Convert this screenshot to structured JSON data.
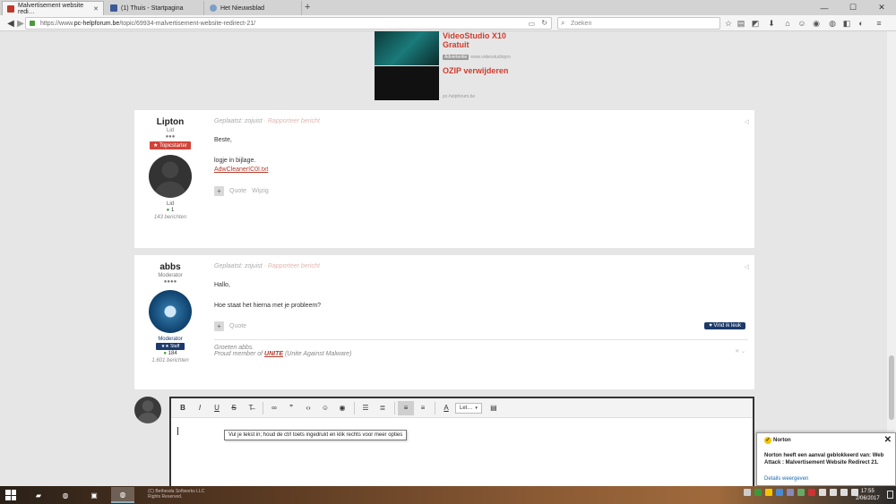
{
  "browser": {
    "tabs": [
      {
        "title": "Malvertisement website redi…",
        "active": true
      },
      {
        "title": "(1) Thuis - Startpagina",
        "active": false
      },
      {
        "title": "Het Nieuwsblad",
        "active": false
      }
    ],
    "new_tab": "+",
    "window": {
      "minimize": "—",
      "maximize": "☐",
      "close": "✕"
    },
    "url_prefix": "https://www.",
    "url_domain": "pc-helpforum.be",
    "url_path": "/topic/69934-malvertisement-website-redirect-21/",
    "search_placeholder": "Zoeken"
  },
  "ads": [
    {
      "title": "VideoStudio X10 Gratuit",
      "badge": "Advertentie",
      "source": "www.videostudiopro"
    },
    {
      "title": "OZIP verwijderen",
      "source": "pc-helpforum.be"
    }
  ],
  "posts": [
    {
      "author": "Lipton",
      "role": "Lid",
      "pips": "●●●",
      "badge": "★ Topicstarter",
      "group": "Lid",
      "reputation": "1",
      "count": "143 berichten",
      "posted": "Geplaatst: zojuist",
      "report": " · Rapporteer bericht",
      "lines": [
        "Beste,",
        "logje in bijlage."
      ],
      "attachment": "AdwCleanerIC0I.txt",
      "actions": [
        "Quote",
        "Wijzig"
      ]
    },
    {
      "author": "abbs",
      "role": "Moderator",
      "pips": "●●●●",
      "group": "Moderator",
      "staff": "★★     Staff",
      "reputation": "184",
      "count": "1.601 berichten",
      "posted": "Geplaatst: zojuist",
      "report": " · Rapporteer bericht",
      "lines": [
        "Hallo,",
        "Hoe staat het hierna met je probleem?"
      ],
      "actions": [
        "Quote"
      ],
      "like": "♥  Vind ik leuk",
      "sig_line1": "Groeten abbs.",
      "sig_prefix": "Proud member of ",
      "sig_unite": "UNITE",
      "sig_suffix": " (Unite Against Malware)"
    }
  ],
  "editor": {
    "font_select": "Let…",
    "tooltip": "Vul je tekst in; houd de ctrl toets ingedrukt en klik rechts voor meer opties"
  },
  "norton": {
    "brand": "Norton",
    "message": "Norton heeft een aanval geblokkeerd van: Web Attack : Malvertisement Website Redirect 21.",
    "link": "Details weergeven"
  },
  "taskbar": {
    "time": "17:55",
    "date": "2/06/2017",
    "wm_line1": "(C) Bethesda Softworks LLC",
    "wm_line2": "Rights Reserved."
  }
}
